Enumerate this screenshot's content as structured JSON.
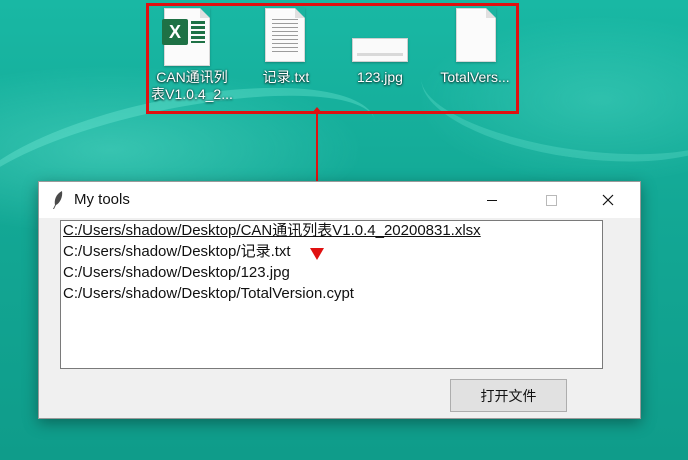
{
  "desktop": {
    "icons": [
      {
        "caption": "CAN通讯列\n表V1.0.4_2...",
        "icon": "excel-file-icon",
        "badge": "X"
      },
      {
        "caption": "记录.txt",
        "icon": "text-file-icon"
      },
      {
        "caption": "123.jpg",
        "icon": "image-file-icon"
      },
      {
        "caption": "TotalVers...",
        "icon": "blank-file-icon"
      }
    ]
  },
  "window": {
    "title": "My tools",
    "icon": "feather-icon",
    "controls": {
      "minimize": "—",
      "maximize": "□",
      "close": "✕"
    },
    "file_list": [
      "C:/Users/shadow/Desktop/CAN通讯列表V1.0.4_20200831.xlsx",
      "C:/Users/shadow/Desktop/记录.txt",
      "C:/Users/shadow/Desktop/123.jpg",
      "C:/Users/shadow/Desktop/TotalVersion.cypt"
    ],
    "open_button_label": "打开文件"
  },
  "colors": {
    "annotation": "#e01010",
    "desktop_bg": "#13a895",
    "excel_green": "#1e7145"
  }
}
